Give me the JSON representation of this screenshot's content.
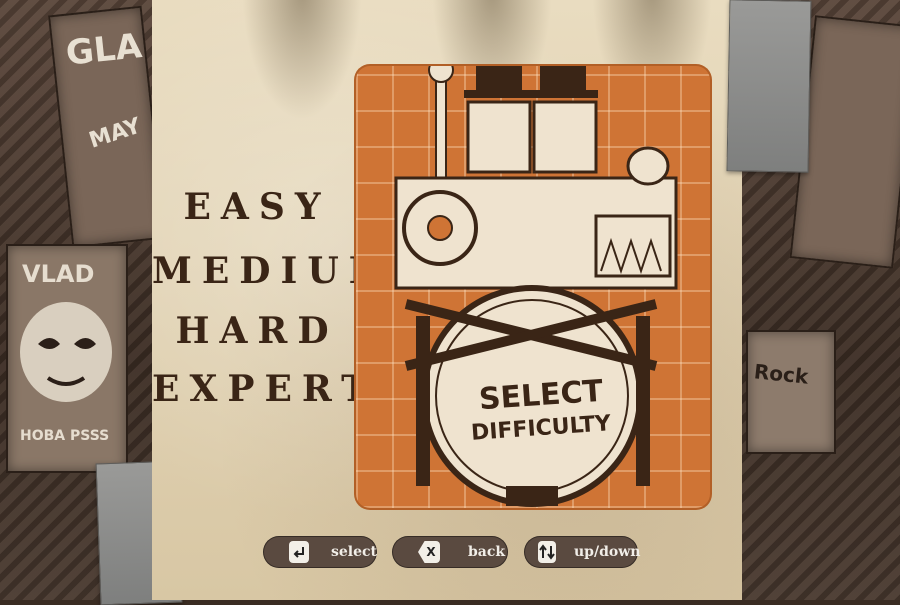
{
  "menu": {
    "title": "SELECT DIFFICULTY",
    "title_lines": [
      "SELECT",
      "DIFFICULTY"
    ],
    "options": [
      "EASY",
      "MEDIUM",
      "HARD",
      "EXPERT"
    ]
  },
  "posters": {
    "left_top": "GLA",
    "left_date": "MAY",
    "left_bottom": "VLAD",
    "left_sign": "HOBA PSSS",
    "right_rock": "Rock"
  },
  "controls": {
    "select": {
      "label": "select",
      "icon": "enter-key-icon"
    },
    "back": {
      "label": "back",
      "key": "X",
      "icon": "x-key-icon"
    },
    "updown": {
      "label": "up/down",
      "icon": "up-down-arrows-icon"
    }
  },
  "colors": {
    "paper": "#e9dcc0",
    "poster_orange": "#cf7435",
    "menu_text": "#3a2516",
    "hint_bg": "#5a4a40"
  }
}
